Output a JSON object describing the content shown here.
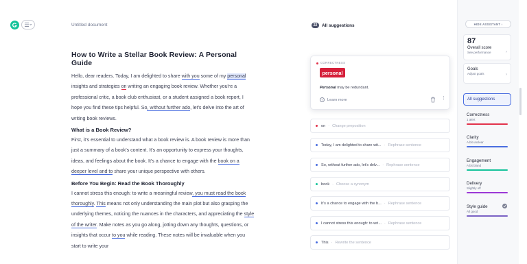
{
  "document": {
    "title": "Untitled document",
    "heading": "How to Write a Stellar Book Review: A Personal Guide",
    "p1": [
      "Hello, dear readers. Today, I am delighted to share ",
      "with you",
      " some of my ",
      "personal",
      " insights and strategies ",
      "on",
      " writing an engaging book review. Whether you're a professional critic, a book club enthusiast, or a student assigned a book report, I hope you find these tips helpful. So",
      ", without further ado",
      ", let's delve into the art of writing book reviews."
    ],
    "h2a": "What is a Book Review?",
    "p2": [
      "First, it's essential to understand what a book review is. A book review is more than just a summary of a book's content. It's an opportunity to express your thoughts, ideas, and feelings about the book. It's a chance to engage with the ",
      "book on a deeper level and to",
      " share your unique perspective with others."
    ],
    "h2b": "Before You Begin: Read the Book Thoroughly",
    "p3": [
      "I cannot stress this enough: to write a meaningful review",
      ", you must read the book thoroughly",
      ". ",
      "This",
      " means not only understanding the main plot but also grasping the underlying themes, noticing the nuances in the characters, and appreciating the ",
      "style of the writer",
      ". Make notes as you go along, jotting down any thoughts, questions, or insights that occur ",
      "to you",
      " while reading. These notes will be invaluable when you start to write your"
    ]
  },
  "suggestions": {
    "count": "22",
    "title": "All suggestions",
    "open_card": {
      "category": "CORRECTNESS",
      "chip": "personal",
      "desc_bold": "Personal",
      "desc_rest": " may be redundant.",
      "learn_more": "Learn more"
    },
    "items": [
      {
        "text": "on",
        "action": "Change preposition"
      },
      {
        "text": "Today, I am delighted to share wit...",
        "action": "Rephrase sentence"
      },
      {
        "text": "So, without further ado, let's delv...",
        "action": "Rephrase sentence"
      },
      {
        "text": "book",
        "action": "Choose a synonym"
      },
      {
        "text": "It's a chance to engage with the b...",
        "action": "Rephrase sentence"
      },
      {
        "text": "I cannot stress this enough: to wri...",
        "action": "Rephrase sentence"
      },
      {
        "text": "This",
        "action": "Rewrite the sentence"
      }
    ],
    "sep": "·"
  },
  "sidebar": {
    "hide_button": "HIDE ASSISTANT",
    "score": "87",
    "score_label": "Overall score",
    "score_sub": "See performance",
    "goals_label": "Goals",
    "goals_sub": "Adjust goals",
    "all_suggestions": "All suggestions",
    "categories": [
      {
        "name": "Correctness",
        "state": "1 alert",
        "color": "#e2314a"
      },
      {
        "name": "Clarity",
        "state": "A bit unclear",
        "color": "#4a6ee0"
      },
      {
        "name": "Engagement",
        "state": "A bit bland",
        "color": "#15c39a"
      },
      {
        "name": "Delivery",
        "state": "Slightly off",
        "color": "#9b38d6"
      },
      {
        "name": "Style guide",
        "state": "All good",
        "color": "#7a62c4"
      }
    ],
    "chevron": "›"
  },
  "colors": {
    "accent": "#4a6ee0",
    "alert": "#e2314a",
    "brand": "#15c39a"
  }
}
